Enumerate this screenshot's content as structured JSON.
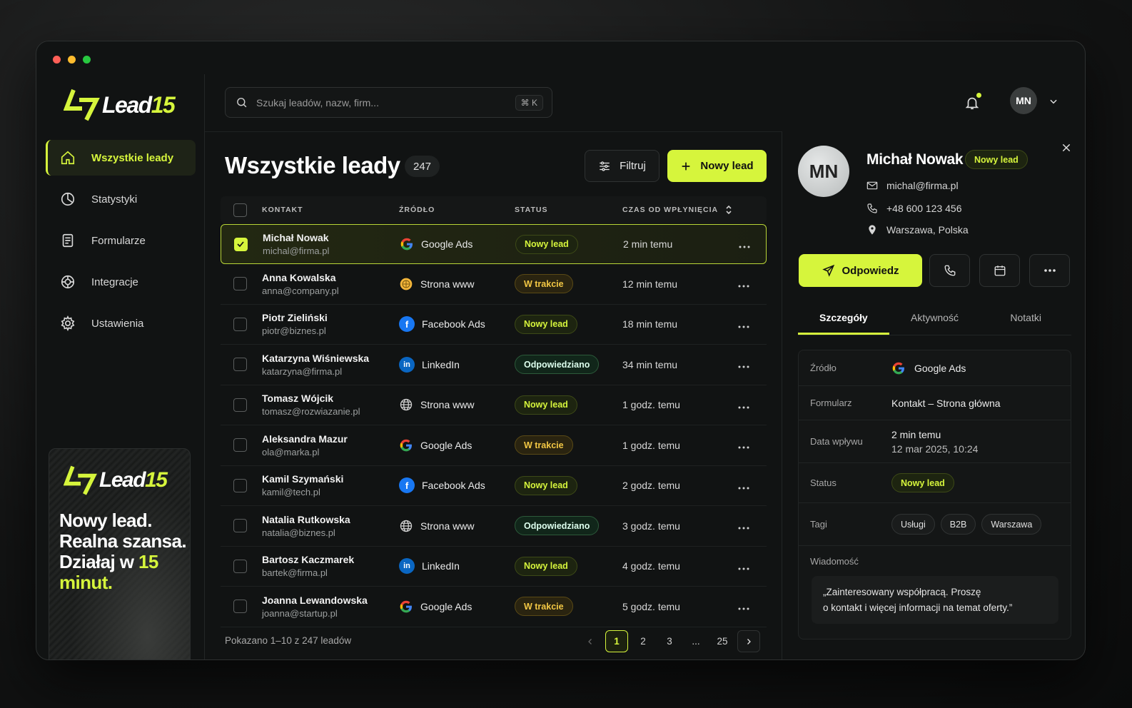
{
  "brand": {
    "name_a": "Lead",
    "name_b": "15",
    "accent": "#d6f53c"
  },
  "nav": [
    {
      "label": "Wszystkie leady",
      "icon": "home-icon",
      "active": true
    },
    {
      "label": "Statystyki",
      "icon": "pie-chart-icon",
      "active": false
    },
    {
      "label": "Formularze",
      "icon": "form-icon",
      "active": false
    },
    {
      "label": "Integracje",
      "icon": "integration-icon",
      "active": false
    },
    {
      "label": "Ustawienia",
      "icon": "gear-icon",
      "active": false
    }
  ],
  "promo": {
    "line1": "Nowy lead.",
    "line2": "Realna szansa.",
    "line3a": "Działaj w",
    "line3b": "15",
    "line4": "minut."
  },
  "search": {
    "placeholder": "Szukaj leadów, nazw, firm...",
    "shortcut": "⌘ K"
  },
  "user": {
    "initials": "MN"
  },
  "main": {
    "title": "Wszystkie leady",
    "count": "247",
    "filter_label": "Filtruj",
    "new_label": "Nowy lead",
    "columns": {
      "contact": "KONTAKT",
      "source": "ŹRÓDŁO",
      "status": "STATUS",
      "time": "CZAS OD WPŁYNIĘCIA"
    },
    "rows": [
      {
        "name": "Michał Nowak",
        "email": "michal@firma.pl",
        "source": "Google Ads",
        "src": "google",
        "status": "Nowy lead",
        "st": "new",
        "time": "2 min temu",
        "selected": true
      },
      {
        "name": "Anna Kowalska",
        "email": "anna@company.pl",
        "source": "Strona www",
        "src": "www-yellow",
        "status": "W trakcie",
        "st": "prog",
        "time": "12 min temu",
        "selected": false
      },
      {
        "name": "Piotr Zieliński",
        "email": "piotr@biznes.pl",
        "source": "Facebook Ads",
        "src": "facebook",
        "status": "Nowy lead",
        "st": "new",
        "time": "18 min temu",
        "selected": false
      },
      {
        "name": "Katarzyna Wiśniewska",
        "email": "katarzyna@firma.pl",
        "source": "LinkedIn",
        "src": "linkedin",
        "status": "Odpowiedziano",
        "st": "done",
        "time": "34 min temu",
        "selected": false
      },
      {
        "name": "Tomasz Wójcik",
        "email": "tomasz@rozwiazanie.pl",
        "source": "Strona www",
        "src": "www",
        "status": "Nowy lead",
        "st": "new",
        "time": "1 godz. temu",
        "selected": false
      },
      {
        "name": "Aleksandra Mazur",
        "email": "ola@marka.pl",
        "source": "Google Ads",
        "src": "google",
        "status": "W trakcie",
        "st": "prog",
        "time": "1 godz. temu",
        "selected": false
      },
      {
        "name": "Kamil Szymański",
        "email": "kamil@tech.pl",
        "source": "Facebook Ads",
        "src": "facebook",
        "status": "Nowy lead",
        "st": "new",
        "time": "2 godz. temu",
        "selected": false
      },
      {
        "name": "Natalia Rutkowska",
        "email": "natalia@biznes.pl",
        "source": "Strona www",
        "src": "www",
        "status": "Odpowiedziano",
        "st": "done",
        "time": "3 godz. temu",
        "selected": false
      },
      {
        "name": "Bartosz Kaczmarek",
        "email": "bartek@firma.pl",
        "source": "LinkedIn",
        "src": "linkedin",
        "status": "Nowy lead",
        "st": "new",
        "time": "4 godz. temu",
        "selected": false
      },
      {
        "name": "Joanna Lewandowska",
        "email": "joanna@startup.pl",
        "source": "Google Ads",
        "src": "google",
        "status": "W trakcie",
        "st": "prog",
        "time": "5 godz. temu",
        "selected": false
      }
    ],
    "footer": "Pokazano 1–10 z 247 leadów",
    "pages": [
      "1",
      "2",
      "3",
      "...",
      "25"
    ]
  },
  "detail": {
    "initials": "MN",
    "name": "Michał Nowak",
    "badge": "Nowy lead",
    "email": "michal@firma.pl",
    "phone": "+48 600 123 456",
    "location": "Warszawa, Polska",
    "reply_label": "Odpowiedz",
    "tabs": [
      "Szczegóły",
      "Aktywność",
      "Notatki"
    ],
    "fields": {
      "source_label": "Źródło",
      "source_value": "Google Ads",
      "form_label": "Formularz",
      "form_value": "Kontakt – Strona główna",
      "date_label": "Data wpływu",
      "date_value1": "2 min temu",
      "date_value2": "12 mar 2025, 10:24",
      "status_label": "Status",
      "status_value": "Nowy lead",
      "tags_label": "Tagi",
      "tags": [
        "Usługi",
        "B2B",
        "Warszawa"
      ],
      "message_label": "Wiadomość",
      "message_line1": "„Zainteresowany współpracą. Proszę",
      "message_line2": "o kontakt i więcej informacji na temat oferty.”"
    }
  }
}
